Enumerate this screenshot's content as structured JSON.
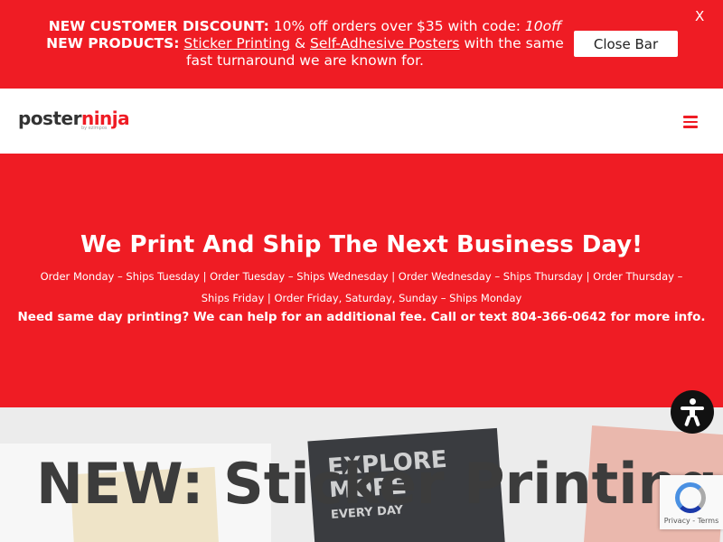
{
  "notice": {
    "discount_label": "NEW CUSTOMER DISCOUNT:",
    "discount_text": " 10% off orders over $35 with code: ",
    "discount_code": "10off",
    "products_label": "NEW PRODUCTS:",
    "link_sticker": "Sticker Printing",
    "amp": " & ",
    "link_posters": "Self-Adhesive Posters",
    "products_tail": " with the same fast turnaround we are known for.",
    "close_button": "Close Bar",
    "close_x": "X"
  },
  "header": {
    "logo_part1": "poster",
    "logo_part2": "ninja",
    "logo_sub": "by ezimpos"
  },
  "hero": {
    "title": "We Print And Ship The Next Business Day!",
    "schedule": "Order Monday – Ships Tuesday  |  Order Tuesday – Ships Wednesday  |  Order Wednesday – Ships Thursday  |  Order Thursday – Ships Friday  |  Order Friday, Saturday, Sunday – Ships Monday",
    "same_day": "Need same day printing? We can help for an additional fee. Call or text 804-366-0642 for more info."
  },
  "feature": {
    "title": "NEW: Sticker Printing!",
    "sticker_text": "EXPLORE MORE",
    "sticker_small": "EVERY DAY"
  },
  "recaptcha": {
    "links": "Privacy - Terms"
  },
  "colors": {
    "brand_red": "#ef1c24",
    "dark": "#3c3c3c"
  }
}
